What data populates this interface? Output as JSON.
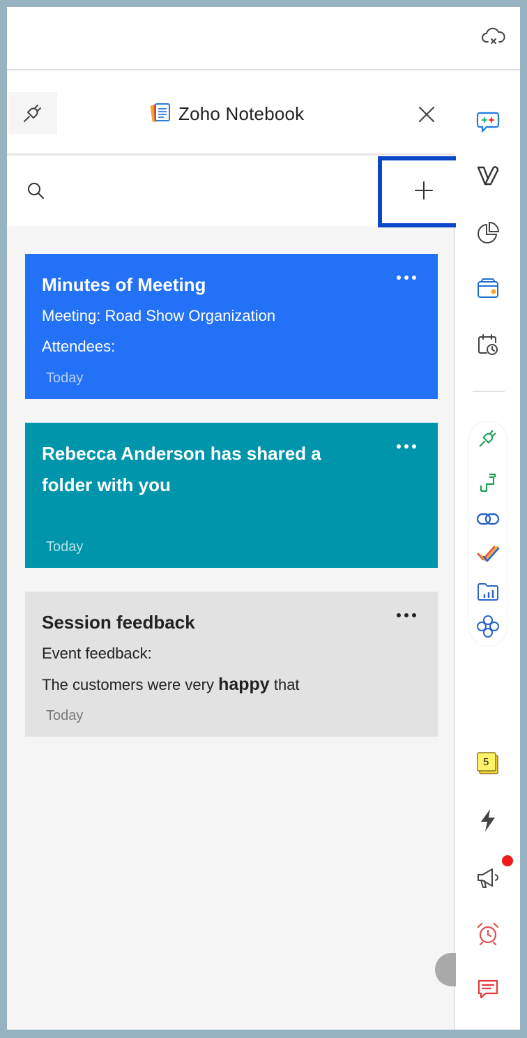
{
  "app": {
    "title": "Zoho Notebook"
  },
  "icons": {
    "cloud": "cloud-x-icon",
    "plug": "plug-icon",
    "notebook_logo": "notebook-logo-icon",
    "close": "close-icon",
    "search": "search-icon",
    "add": "plus-icon",
    "more": "more-horizontal-icon"
  },
  "notes": [
    {
      "title": "Minutes of Meeting",
      "lines": [
        "Meeting: Road Show Organization",
        "Attendees:"
      ],
      "date": "Today",
      "color": "#2271f7"
    },
    {
      "title_line1": "Rebecca Anderson has shared a",
      "title_line2": "folder with you",
      "date": "Today",
      "color": "#0095aa"
    },
    {
      "title": "Session feedback",
      "line1": "Event feedback:",
      "line2_pre": "The customers were very",
      "line2_bold": "happy",
      "line2_post": "that",
      "date": "Today",
      "color": "#e2e2e2"
    }
  ],
  "sidebar": {
    "items": [
      "chat-spark-icon",
      "v-logo-icon",
      "pie-chart-icon",
      "wallet-icon",
      "calendar-clock-icon",
      "plug-icon",
      "route-icon",
      "link-icon",
      "checkmark-icon",
      "folder-chart-icon",
      "flower-icon",
      "sticky-notes-icon",
      "lightning-icon",
      "megaphone-icon",
      "alarm-clock-icon",
      "message-icon"
    ],
    "sticky_notes_count": "5",
    "notification_dot_color": "#f01a1a"
  },
  "accent": "#0a46c8"
}
